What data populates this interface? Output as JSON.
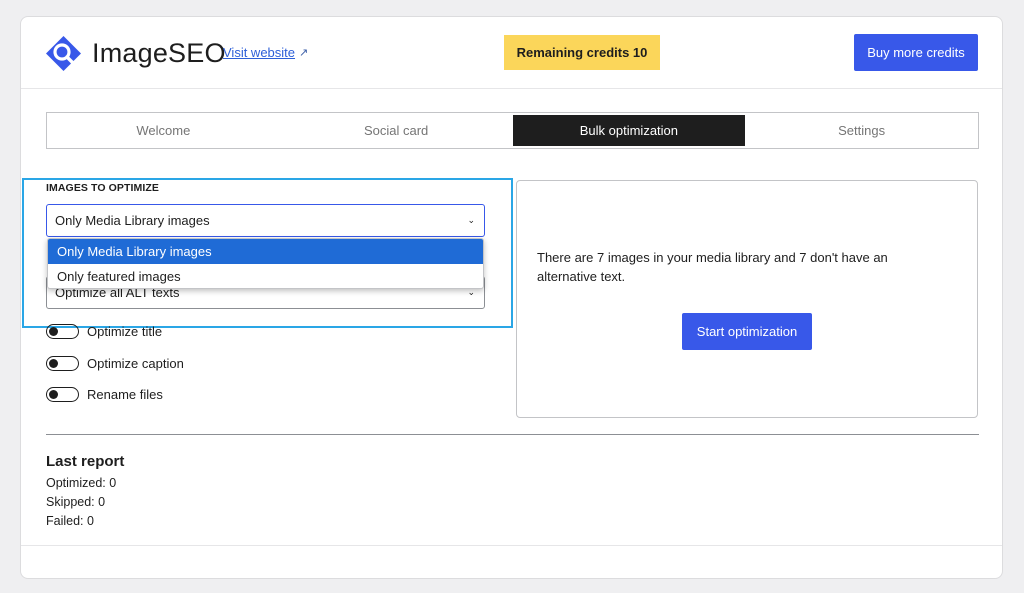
{
  "header": {
    "brand": "ImageSEO",
    "visit_label": "Visit website",
    "visit_icon": "external-link-icon",
    "credits_label": "Remaining credits 10",
    "buy_label": "Buy more credits",
    "colors": {
      "accent": "#3858e9",
      "credits_bg": "#fbd65a"
    }
  },
  "tabs": [
    {
      "label": "Welcome",
      "active": false
    },
    {
      "label": "Social card",
      "active": false
    },
    {
      "label": "Bulk optimization",
      "active": true
    },
    {
      "label": "Settings",
      "active": false
    }
  ],
  "images_to_optimize": {
    "label": "IMAGES TO OPTIMIZE",
    "selected": "Only Media Library images",
    "options": [
      "Only Media Library images",
      "Only featured images"
    ]
  },
  "alt_select": {
    "selected": "Optimize all ALT texts"
  },
  "toggles": [
    {
      "label": "Optimize title",
      "on": false
    },
    {
      "label": "Optimize caption",
      "on": false
    },
    {
      "label": "Rename files",
      "on": false
    }
  ],
  "panel": {
    "message": "There are 7 images in your media library and 7 don't have an alternative text.",
    "start_label": "Start optimization"
  },
  "report": {
    "title": "Last report",
    "optimized": "Optimized: 0",
    "skipped": "Skipped: 0",
    "failed": "Failed: 0"
  }
}
